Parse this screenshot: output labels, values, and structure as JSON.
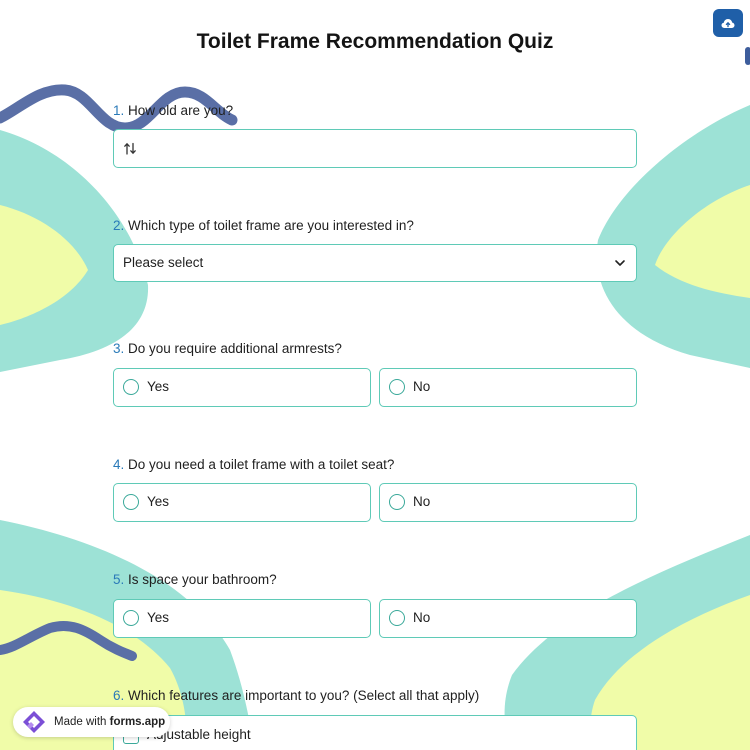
{
  "form": {
    "title": "Toilet Frame Recommendation Quiz"
  },
  "questions": {
    "q1": {
      "number": "1.",
      "text": "How old are you?",
      "value": ""
    },
    "q2": {
      "number": "2.",
      "text": "Which type of toilet frame are you interested in?",
      "selected": "Please select"
    },
    "q3": {
      "number": "3.",
      "text": "Do you require additional armrests?",
      "options": [
        "Yes",
        "No"
      ]
    },
    "q4": {
      "number": "4.",
      "text": "Do you need a toilet frame with a toilet seat?",
      "options": [
        "Yes",
        "No"
      ]
    },
    "q5": {
      "number": "5.",
      "text": "Is space your bathroom?",
      "options": [
        "Yes",
        "No"
      ]
    },
    "q6": {
      "number": "6.",
      "text": "Which features are important to you? (Select all that apply)",
      "options": [
        "Adjustable height"
      ]
    }
  },
  "badge": {
    "prefix": "Made with ",
    "brand": "forms.app"
  },
  "icons": {
    "upload": "cloud-upload-icon",
    "number": "number-sort-icon",
    "dropdown": "chevron-down-icon",
    "logo": "forms-app-logo"
  },
  "colors": {
    "accent": "#1f5fa8",
    "field_border": "#5fcab7",
    "teal_shape": "#9de2d6",
    "yellow_shape": "#f0fca8",
    "squiggle": "#5a6fa6"
  }
}
